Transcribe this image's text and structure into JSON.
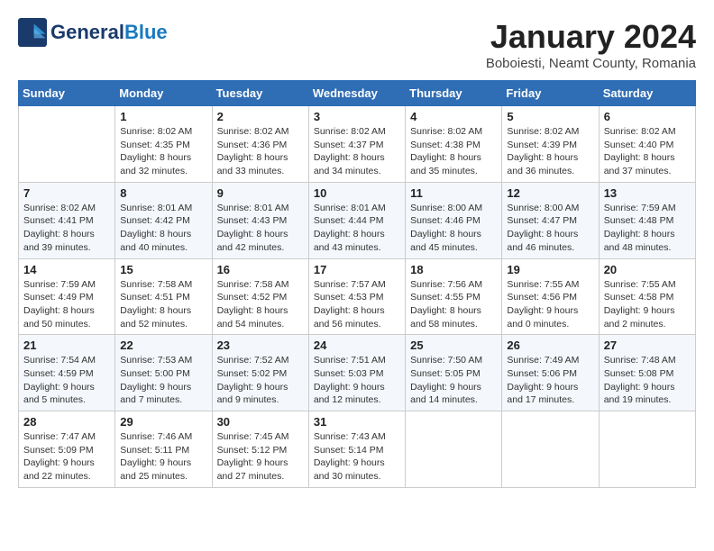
{
  "logo": {
    "line1": "General",
    "line2": "Blue"
  },
  "title": "January 2024",
  "subtitle": "Boboiesti, Neamt County, Romania",
  "days_of_week": [
    "Sunday",
    "Monday",
    "Tuesday",
    "Wednesday",
    "Thursday",
    "Friday",
    "Saturday"
  ],
  "weeks": [
    [
      {
        "num": "",
        "info": ""
      },
      {
        "num": "1",
        "info": "Sunrise: 8:02 AM\nSunset: 4:35 PM\nDaylight: 8 hours\nand 32 minutes."
      },
      {
        "num": "2",
        "info": "Sunrise: 8:02 AM\nSunset: 4:36 PM\nDaylight: 8 hours\nand 33 minutes."
      },
      {
        "num": "3",
        "info": "Sunrise: 8:02 AM\nSunset: 4:37 PM\nDaylight: 8 hours\nand 34 minutes."
      },
      {
        "num": "4",
        "info": "Sunrise: 8:02 AM\nSunset: 4:38 PM\nDaylight: 8 hours\nand 35 minutes."
      },
      {
        "num": "5",
        "info": "Sunrise: 8:02 AM\nSunset: 4:39 PM\nDaylight: 8 hours\nand 36 minutes."
      },
      {
        "num": "6",
        "info": "Sunrise: 8:02 AM\nSunset: 4:40 PM\nDaylight: 8 hours\nand 37 minutes."
      }
    ],
    [
      {
        "num": "7",
        "info": "Sunrise: 8:02 AM\nSunset: 4:41 PM\nDaylight: 8 hours\nand 39 minutes."
      },
      {
        "num": "8",
        "info": "Sunrise: 8:01 AM\nSunset: 4:42 PM\nDaylight: 8 hours\nand 40 minutes."
      },
      {
        "num": "9",
        "info": "Sunrise: 8:01 AM\nSunset: 4:43 PM\nDaylight: 8 hours\nand 42 minutes."
      },
      {
        "num": "10",
        "info": "Sunrise: 8:01 AM\nSunset: 4:44 PM\nDaylight: 8 hours\nand 43 minutes."
      },
      {
        "num": "11",
        "info": "Sunrise: 8:00 AM\nSunset: 4:46 PM\nDaylight: 8 hours\nand 45 minutes."
      },
      {
        "num": "12",
        "info": "Sunrise: 8:00 AM\nSunset: 4:47 PM\nDaylight: 8 hours\nand 46 minutes."
      },
      {
        "num": "13",
        "info": "Sunrise: 7:59 AM\nSunset: 4:48 PM\nDaylight: 8 hours\nand 48 minutes."
      }
    ],
    [
      {
        "num": "14",
        "info": "Sunrise: 7:59 AM\nSunset: 4:49 PM\nDaylight: 8 hours\nand 50 minutes."
      },
      {
        "num": "15",
        "info": "Sunrise: 7:58 AM\nSunset: 4:51 PM\nDaylight: 8 hours\nand 52 minutes."
      },
      {
        "num": "16",
        "info": "Sunrise: 7:58 AM\nSunset: 4:52 PM\nDaylight: 8 hours\nand 54 minutes."
      },
      {
        "num": "17",
        "info": "Sunrise: 7:57 AM\nSunset: 4:53 PM\nDaylight: 8 hours\nand 56 minutes."
      },
      {
        "num": "18",
        "info": "Sunrise: 7:56 AM\nSunset: 4:55 PM\nDaylight: 8 hours\nand 58 minutes."
      },
      {
        "num": "19",
        "info": "Sunrise: 7:55 AM\nSunset: 4:56 PM\nDaylight: 9 hours\nand 0 minutes."
      },
      {
        "num": "20",
        "info": "Sunrise: 7:55 AM\nSunset: 4:58 PM\nDaylight: 9 hours\nand 2 minutes."
      }
    ],
    [
      {
        "num": "21",
        "info": "Sunrise: 7:54 AM\nSunset: 4:59 PM\nDaylight: 9 hours\nand 5 minutes."
      },
      {
        "num": "22",
        "info": "Sunrise: 7:53 AM\nSunset: 5:00 PM\nDaylight: 9 hours\nand 7 minutes."
      },
      {
        "num": "23",
        "info": "Sunrise: 7:52 AM\nSunset: 5:02 PM\nDaylight: 9 hours\nand 9 minutes."
      },
      {
        "num": "24",
        "info": "Sunrise: 7:51 AM\nSunset: 5:03 PM\nDaylight: 9 hours\nand 12 minutes."
      },
      {
        "num": "25",
        "info": "Sunrise: 7:50 AM\nSunset: 5:05 PM\nDaylight: 9 hours\nand 14 minutes."
      },
      {
        "num": "26",
        "info": "Sunrise: 7:49 AM\nSunset: 5:06 PM\nDaylight: 9 hours\nand 17 minutes."
      },
      {
        "num": "27",
        "info": "Sunrise: 7:48 AM\nSunset: 5:08 PM\nDaylight: 9 hours\nand 19 minutes."
      }
    ],
    [
      {
        "num": "28",
        "info": "Sunrise: 7:47 AM\nSunset: 5:09 PM\nDaylight: 9 hours\nand 22 minutes."
      },
      {
        "num": "29",
        "info": "Sunrise: 7:46 AM\nSunset: 5:11 PM\nDaylight: 9 hours\nand 25 minutes."
      },
      {
        "num": "30",
        "info": "Sunrise: 7:45 AM\nSunset: 5:12 PM\nDaylight: 9 hours\nand 27 minutes."
      },
      {
        "num": "31",
        "info": "Sunrise: 7:43 AM\nSunset: 5:14 PM\nDaylight: 9 hours\nand 30 minutes."
      },
      {
        "num": "",
        "info": ""
      },
      {
        "num": "",
        "info": ""
      },
      {
        "num": "",
        "info": ""
      }
    ]
  ]
}
